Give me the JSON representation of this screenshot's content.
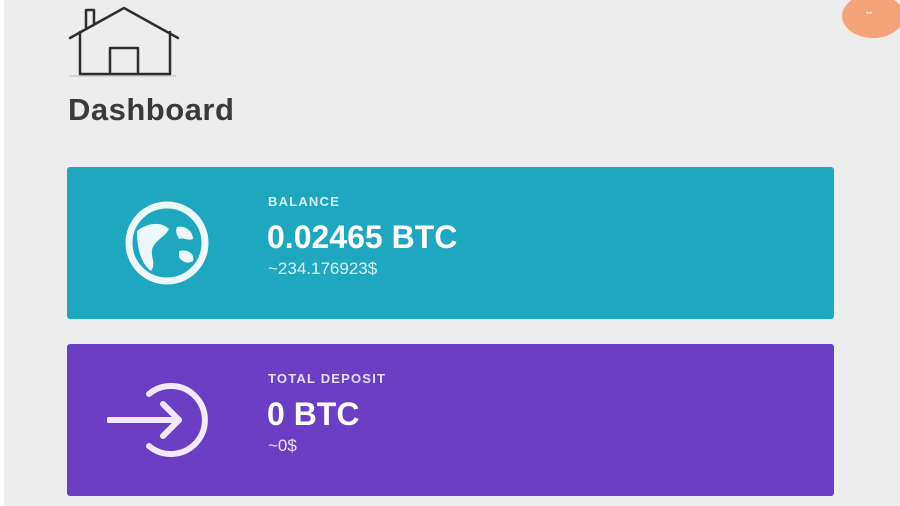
{
  "header": {
    "home_icon": "home-icon",
    "title": "Dashboard",
    "avatar_icon": "user-avatar"
  },
  "cards": {
    "balance": {
      "icon": "globe-icon",
      "label": "BALANCE",
      "value": "0.02465 BTC",
      "sub": "~234.176923$",
      "color": "#1fa7bf"
    },
    "deposit": {
      "icon": "sign-in-icon",
      "label": "TOTAL DEPOSIT",
      "value": "0 BTC",
      "sub": "~0$",
      "color": "#6b3fc4"
    }
  },
  "colors": {
    "background": "#ededed",
    "title": "#3a3a3a",
    "avatar": "#f5a47a"
  }
}
